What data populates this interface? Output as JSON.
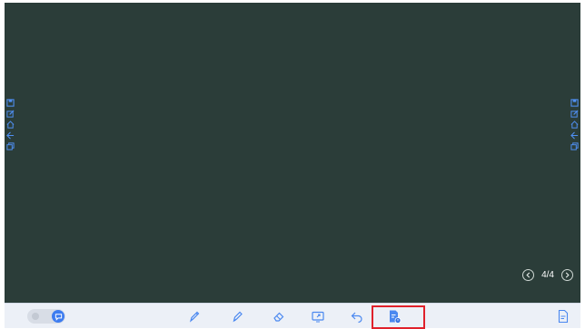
{
  "board": {
    "background_color": "#2b3d39"
  },
  "side_tools": {
    "icons": [
      "save-icon",
      "edit-icon",
      "home-icon",
      "back-icon",
      "copy-icon"
    ]
  },
  "pager": {
    "label": "4/4",
    "prev_icon": "chevron-left-icon",
    "next_icon": "chevron-right-icon"
  },
  "toolbar": {
    "toggle_state": "on",
    "tools": [
      "pen-icon",
      "highlighter-icon",
      "eraser-icon",
      "screen-capture-icon",
      "undo-icon",
      "file-info-icon"
    ],
    "right_tool": "document-icon",
    "highlighted_tool": "file-info-icon",
    "accent_color": "#3d7cf0",
    "highlight_color": "#e0212b"
  }
}
